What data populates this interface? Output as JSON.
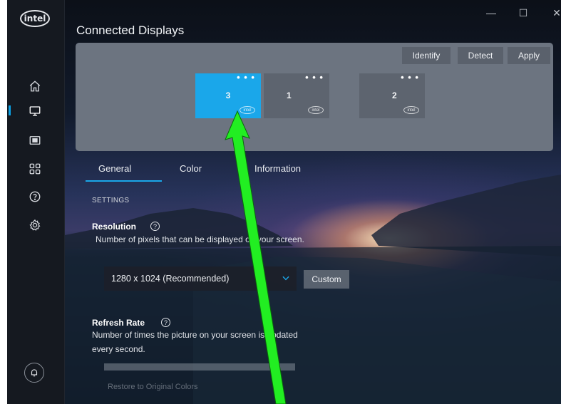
{
  "brand": {
    "logo_text": "intel"
  },
  "header": {
    "title": "Connected Displays"
  },
  "window_controls": {
    "minimize": "—",
    "maximize": "☐",
    "close": "✕"
  },
  "sidebar": {
    "items": [
      {
        "icon": "home-icon"
      },
      {
        "icon": "display-icon",
        "active": true
      },
      {
        "icon": "video-icon"
      },
      {
        "icon": "apps-icon"
      },
      {
        "icon": "help-icon"
      },
      {
        "icon": "gear-icon"
      }
    ],
    "notification_icon": "bell-icon"
  },
  "toolbar": {
    "identify": "Identify",
    "detect": "Detect",
    "apply": "Apply"
  },
  "displays": [
    {
      "number": "3",
      "menu": "• • •",
      "selected": true,
      "logo": "intel"
    },
    {
      "number": "1",
      "menu": "• • •",
      "selected": false,
      "logo": "intel"
    },
    {
      "number": "2",
      "menu": "• • •",
      "selected": false,
      "logo": "intel"
    }
  ],
  "tabs": {
    "general": "General",
    "color": "Color",
    "information": "Information"
  },
  "settings_heading": "SETTINGS",
  "resolution": {
    "label": "Resolution",
    "help": "?",
    "description": "Number of pixels that can be displayed on your screen.",
    "value": "1280 x 1024 (Recommended)",
    "custom_button": "Custom"
  },
  "refresh_rate": {
    "label": "Refresh Rate",
    "help": "?",
    "description_line1": "Number of times the picture on your screen is updated",
    "description_line2": "every second."
  },
  "restore": "Restore to Original Colors",
  "colors": {
    "accent": "#1aa7ea",
    "panel": "#6c7480",
    "arrow": "#22ee22"
  }
}
